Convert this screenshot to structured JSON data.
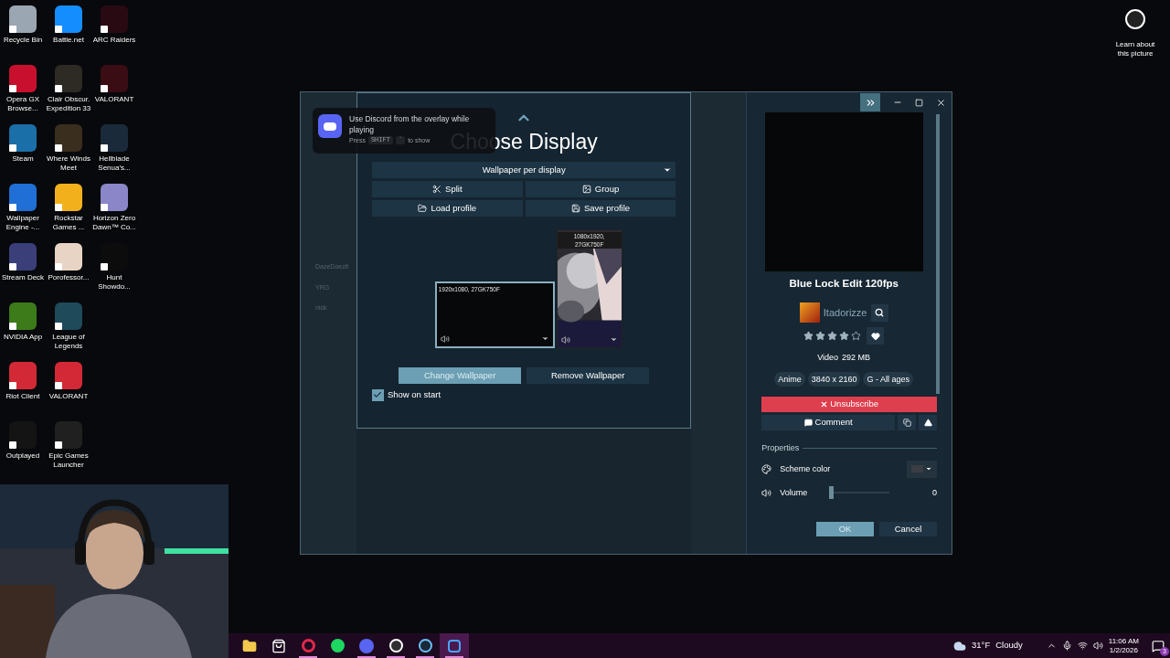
{
  "desktop_columns": [
    [
      {
        "label": "Recycle Bin",
        "color": "#9aa6b2"
      },
      {
        "label": "Opera GX Browse...",
        "color": "#c8102e"
      },
      {
        "label": "Steam",
        "color": "#1b6fa8"
      },
      {
        "label": "Wallpaper Engine -...",
        "color": "#1f6fd6"
      },
      {
        "label": "Stream Deck",
        "color": "#3a3f7a"
      },
      {
        "label": "NVIDIA App",
        "color": "#3c7a1a"
      },
      {
        "label": "Riot Client",
        "color": "#d32936"
      },
      {
        "label": "Outplayed",
        "color": "#141414"
      }
    ],
    [
      {
        "label": "Battle.net",
        "color": "#148eff"
      },
      {
        "label": "Clair Obscur. Expedition 33",
        "color": "#2e2a24"
      },
      {
        "label": "Where Winds Meet",
        "color": "#3a2e1e"
      },
      {
        "label": "Rockstar Games ...",
        "color": "#f2b11c"
      },
      {
        "label": "Porofessor...",
        "color": "#e8d4c4"
      },
      {
        "label": "League of Legends",
        "color": "#1e4a5a"
      },
      {
        "label": "VALORANT",
        "color": "#d32936"
      },
      {
        "label": "Epic Games Launcher",
        "color": "#202020"
      }
    ],
    [
      {
        "label": "ARC Raiders",
        "color": "#2a0a12"
      },
      {
        "label": "VALORANT",
        "color": "#3a0c14"
      },
      {
        "label": "Hellblade Senua's...",
        "color": "#1a2a3a"
      },
      {
        "label": "Horizon Zero Dawn™ Co...",
        "color": "#8a86c8"
      },
      {
        "label": "Hunt Showdo...",
        "color": "#0c0c0c"
      }
    ]
  ],
  "learn_picture": {
    "label": "Learn about this picture"
  },
  "discord_overlay": {
    "message": "Use Discord from the overlay while playing",
    "press": "Press",
    "keys": [
      "SHIFT",
      "`"
    ],
    "suffix": "to show"
  },
  "blurred_users": [
    "DazeDoezit",
    "YRG",
    "nick"
  ],
  "choose_display": {
    "title": "Choose Display",
    "mode": "Wallpaper per display",
    "actions": [
      {
        "label": "Split",
        "kind": "split"
      },
      {
        "label": "Group",
        "kind": "group"
      },
      {
        "label": "Load profile",
        "kind": "load"
      },
      {
        "label": "Save profile",
        "kind": "save"
      }
    ],
    "monitors": [
      {
        "label": "1920x1080, 27GK750F",
        "kind": "landscape",
        "selected": true
      },
      {
        "label": "1080x1920, 27GK750F",
        "kind": "portrait",
        "selected": false
      }
    ],
    "buttons": [
      {
        "label": "Change Wallpaper",
        "selected": true
      },
      {
        "label": "Remove Wallpaper",
        "selected": false
      }
    ],
    "show_on_start": {
      "label": "Show on start",
      "checked": true
    }
  },
  "details": {
    "title": "Blue Lock Edit 120fps",
    "author": "Itadorizze",
    "stars": 4,
    "type": "Video",
    "size": "292 MB",
    "tags": [
      "Anime",
      "3840 x 2160",
      "G - All ages"
    ],
    "unsubscribe": "Unsubscribe",
    "comment": "Comment",
    "properties_heading": "Properties",
    "properties": [
      {
        "kind": "color",
        "label": "Scheme color"
      },
      {
        "kind": "slider",
        "label": "Volume",
        "level": 0,
        "value": "0"
      }
    ],
    "ok": "OK",
    "cancel": "Cancel"
  },
  "taskbar": {
    "apps": [
      {
        "kind": "explorer",
        "running": false,
        "selected": false
      },
      {
        "kind": "store",
        "running": false,
        "selected": false
      },
      {
        "kind": "opera",
        "running": true,
        "selected": false
      },
      {
        "kind": "spotify",
        "running": false,
        "selected": false
      },
      {
        "kind": "discord",
        "running": true,
        "selected": false
      },
      {
        "kind": "obs",
        "running": true,
        "selected": false
      },
      {
        "kind": "steam",
        "running": true,
        "selected": false
      },
      {
        "kind": "wallpaper",
        "running": true,
        "selected": true
      }
    ],
    "weather": {
      "temp": "31°F",
      "condition": "Cloudy"
    },
    "time": "11:06 AM",
    "date": "1/2/2026",
    "notifications": "3"
  }
}
